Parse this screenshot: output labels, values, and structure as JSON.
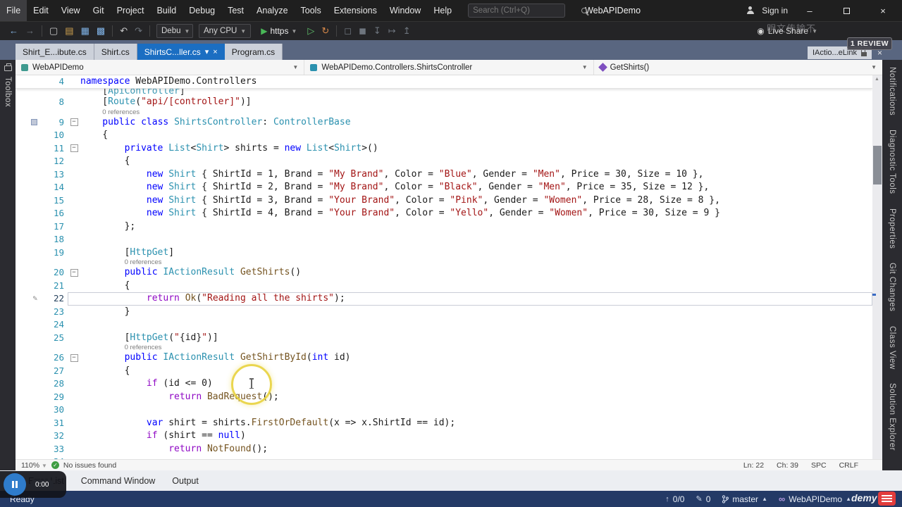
{
  "titlebar": {
    "menus": [
      "File",
      "Edit",
      "View",
      "Git",
      "Project",
      "Build",
      "Debug",
      "Test",
      "Analyze",
      "Tools",
      "Extensions",
      "Window",
      "Help"
    ],
    "search_placeholder": "Search (Ctrl+Q)",
    "app_title": "WebAPIDemo",
    "sign_in": "Sign in"
  },
  "toolbar": {
    "config_dropdown": "Debu",
    "platform_dropdown": "Any CPU",
    "run_label": "https",
    "live_share": "Live Share",
    "icons_left": [
      {
        "name": "nav-back-icon",
        "glyph": "←",
        "color": "#85b4e4"
      },
      {
        "name": "nav-forward-icon",
        "glyph": "→",
        "color": "#6e757e"
      },
      {
        "name": "sep"
      },
      {
        "name": "new-file-icon",
        "glyph": "▢",
        "color": "#c9c9c9"
      },
      {
        "name": "open-file-icon",
        "glyph": "▤",
        "color": "#cfa14f"
      },
      {
        "name": "save-icon",
        "glyph": "▦",
        "color": "#7fb2e6"
      },
      {
        "name": "save-all-icon",
        "glyph": "▩",
        "color": "#7fb2e6"
      },
      {
        "name": "sep"
      },
      {
        "name": "undo-icon",
        "glyph": "↶",
        "color": "#c9c9c9"
      },
      {
        "name": "redo-icon",
        "glyph": "↷",
        "color": "#6e757e"
      },
      {
        "name": "sep"
      }
    ],
    "icons_mid": [
      {
        "name": "run-without-debug-icon",
        "glyph": "▷",
        "color": "#5fbe6a"
      },
      {
        "name": "hot-reload-icon",
        "glyph": "↻",
        "color": "#d98a4a"
      },
      {
        "name": "sep"
      },
      {
        "name": "break-all-icon",
        "glyph": "◻",
        "color": "#6e757e"
      },
      {
        "name": "stop-icon",
        "glyph": "◼",
        "color": "#6e757e"
      },
      {
        "name": "step-into-icon",
        "glyph": "↧",
        "color": "#6e757e"
      },
      {
        "name": "step-over-icon",
        "glyph": "↦",
        "color": "#6e757e"
      },
      {
        "name": "step-out-icon",
        "glyph": "↥",
        "color": "#6e757e"
      }
    ]
  },
  "watermarks": {
    "top": "明文传输不",
    "review": "1 REVIEW",
    "bottom": "demy"
  },
  "tabs": {
    "items": [
      {
        "label": "Shirt_E...ibute.cs",
        "active": false
      },
      {
        "label": "Shirt.cs",
        "active": false
      },
      {
        "label": "ShirtsC...ller.cs",
        "active": true
      },
      {
        "label": "Program.cs",
        "active": false
      }
    ],
    "floating_tab": "IActio...eLink"
  },
  "breadcrumb": {
    "project": "WebAPIDemo",
    "type": "WebAPIDemo.Controllers.ShirtsController",
    "member": "GetShirts()"
  },
  "left_strip": {
    "label": "Toolbox"
  },
  "right_strip": {
    "labels": [
      "Notifications",
      "Diagnostic Tools",
      "Properties",
      "Git Changes",
      "Class View",
      "Solution Explorer"
    ]
  },
  "editor": {
    "sticky": {
      "n": "4",
      "ind": 0,
      "tokens": [
        [
          "k",
          "namespace"
        ],
        [
          "p",
          " WebAPIDemo.Controllers"
        ]
      ]
    },
    "lines": [
      {
        "n": "",
        "ind": 1,
        "partial": true,
        "tokens": [
          [
            "p",
            "["
          ],
          [
            "t",
            "ApiController"
          ],
          [
            "p",
            "]"
          ]
        ]
      },
      {
        "n": "8",
        "ind": 1,
        "tokens": [
          [
            "p",
            "["
          ],
          [
            "t",
            "Route"
          ],
          [
            "p",
            "("
          ],
          [
            "s",
            "\"api/[controller]\""
          ],
          [
            "p",
            ")]"
          ]
        ]
      },
      {
        "lens": "0 references",
        "ind": 1
      },
      {
        "n": "9",
        "ind": 1,
        "fold": true,
        "mark": true,
        "tokens": [
          [
            "k",
            "public"
          ],
          [
            "p",
            " "
          ],
          [
            "k",
            "class"
          ],
          [
            "p",
            " "
          ],
          [
            "t",
            "ShirtsController"
          ],
          [
            "p",
            ": "
          ],
          [
            "t",
            "ControllerBase"
          ]
        ]
      },
      {
        "n": "10",
        "ind": 1,
        "tokens": [
          [
            "p",
            "{"
          ]
        ]
      },
      {
        "n": "11",
        "ind": 2,
        "fold": true,
        "tokens": [
          [
            "k",
            "private"
          ],
          [
            "p",
            " "
          ],
          [
            "t",
            "List"
          ],
          [
            "p",
            "<"
          ],
          [
            "t",
            "Shirt"
          ],
          [
            "p",
            "> shirts = "
          ],
          [
            "k",
            "new"
          ],
          [
            "p",
            " "
          ],
          [
            "t",
            "List"
          ],
          [
            "p",
            "<"
          ],
          [
            "t",
            "Shirt"
          ],
          [
            "p",
            ">()"
          ]
        ]
      },
      {
        "n": "12",
        "ind": 2,
        "tokens": [
          [
            "p",
            "{"
          ]
        ]
      },
      {
        "n": "13",
        "ind": 3,
        "tokens": [
          [
            "k",
            "new"
          ],
          [
            "p",
            " "
          ],
          [
            "t",
            "Shirt"
          ],
          [
            "p",
            " { ShirtId = 1, Brand = "
          ],
          [
            "s",
            "\"My Brand\""
          ],
          [
            "p",
            ", Color = "
          ],
          [
            "s",
            "\"Blue\""
          ],
          [
            "p",
            ", Gender = "
          ],
          [
            "s",
            "\"Men\""
          ],
          [
            "p",
            ", Price = 30, Size = 10 },"
          ]
        ]
      },
      {
        "n": "14",
        "ind": 3,
        "tokens": [
          [
            "k",
            "new"
          ],
          [
            "p",
            " "
          ],
          [
            "t",
            "Shirt"
          ],
          [
            "p",
            " { ShirtId = 2, Brand = "
          ],
          [
            "s",
            "\"My Brand\""
          ],
          [
            "p",
            ", Color = "
          ],
          [
            "s",
            "\"Black\""
          ],
          [
            "p",
            ", Gender = "
          ],
          [
            "s",
            "\"Men\""
          ],
          [
            "p",
            ", Price = 35, Size = 12 },"
          ]
        ]
      },
      {
        "n": "15",
        "ind": 3,
        "tokens": [
          [
            "k",
            "new"
          ],
          [
            "p",
            " "
          ],
          [
            "t",
            "Shirt"
          ],
          [
            "p",
            " { ShirtId = 3, Brand = "
          ],
          [
            "s",
            "\"Your Brand\""
          ],
          [
            "p",
            ", Color = "
          ],
          [
            "s",
            "\"Pink\""
          ],
          [
            "p",
            ", Gender = "
          ],
          [
            "s",
            "\"Women\""
          ],
          [
            "p",
            ", Price = 28, Size = 8 },"
          ]
        ]
      },
      {
        "n": "16",
        "ind": 3,
        "tokens": [
          [
            "k",
            "new"
          ],
          [
            "p",
            " "
          ],
          [
            "t",
            "Shirt"
          ],
          [
            "p",
            " { ShirtId = 4, Brand = "
          ],
          [
            "s",
            "\"Your Brand\""
          ],
          [
            "p",
            ", Color = "
          ],
          [
            "s",
            "\"Yello\""
          ],
          [
            "p",
            ", Gender = "
          ],
          [
            "s",
            "\"Women\""
          ],
          [
            "p",
            ", Price = 30, Size = 9 }"
          ]
        ]
      },
      {
        "n": "17",
        "ind": 2,
        "tokens": [
          [
            "p",
            "};"
          ]
        ]
      },
      {
        "n": "18",
        "ind": 0,
        "tokens": []
      },
      {
        "n": "19",
        "ind": 2,
        "tokens": [
          [
            "p",
            "["
          ],
          [
            "t",
            "HttpGet"
          ],
          [
            "p",
            "]"
          ]
        ]
      },
      {
        "lens": "0 references",
        "ind": 2
      },
      {
        "n": "20",
        "ind": 2,
        "fold": true,
        "tokens": [
          [
            "k",
            "public"
          ],
          [
            "p",
            " "
          ],
          [
            "t",
            "IActionResult"
          ],
          [
            "p",
            " "
          ],
          [
            "m",
            "GetShirts"
          ],
          [
            "p",
            "()"
          ]
        ]
      },
      {
        "n": "21",
        "ind": 2,
        "tokens": [
          [
            "p",
            "{"
          ]
        ]
      },
      {
        "n": "22",
        "ind": 3,
        "cur": true,
        "pencil": true,
        "tokens": [
          [
            "c",
            "return"
          ],
          [
            "p",
            " "
          ],
          [
            "m",
            "Ok"
          ],
          [
            "p",
            "("
          ],
          [
            "s",
            "\"Reading all the shirts\""
          ],
          [
            "p",
            ");"
          ]
        ]
      },
      {
        "n": "23",
        "ind": 2,
        "tokens": [
          [
            "p",
            "}"
          ]
        ]
      },
      {
        "n": "24",
        "ind": 0,
        "tokens": []
      },
      {
        "n": "25",
        "ind": 2,
        "tokens": [
          [
            "p",
            "["
          ],
          [
            "t",
            "HttpGet"
          ],
          [
            "p",
            "("
          ],
          [
            "s",
            "\""
          ],
          [
            "p",
            "{id}"
          ],
          [
            "s",
            "\""
          ],
          [
            "p",
            ")]"
          ]
        ]
      },
      {
        "lens": "0 references",
        "ind": 2
      },
      {
        "n": "26",
        "ind": 2,
        "fold": true,
        "tokens": [
          [
            "k",
            "public"
          ],
          [
            "p",
            " "
          ],
          [
            "t",
            "IActionResult"
          ],
          [
            "p",
            " "
          ],
          [
            "m",
            "GetShirtById"
          ],
          [
            "p",
            "("
          ],
          [
            "k",
            "int"
          ],
          [
            "p",
            " id)"
          ]
        ]
      },
      {
        "n": "27",
        "ind": 2,
        "tokens": [
          [
            "p",
            "{"
          ]
        ]
      },
      {
        "n": "28",
        "ind": 3,
        "tokens": [
          [
            "c",
            "if"
          ],
          [
            "p",
            " (id <= 0)"
          ]
        ]
      },
      {
        "n": "29",
        "ind": 4,
        "tokens": [
          [
            "c",
            "return"
          ],
          [
            "p",
            " "
          ],
          [
            "m",
            "BadRequest"
          ],
          [
            "p",
            "();"
          ]
        ]
      },
      {
        "n": "30",
        "ind": 0,
        "tokens": []
      },
      {
        "n": "31",
        "ind": 3,
        "tokens": [
          [
            "k",
            "var"
          ],
          [
            "p",
            " shirt = shirts."
          ],
          [
            "m",
            "FirstOrDefault"
          ],
          [
            "p",
            "(x => x.ShirtId == id);"
          ]
        ]
      },
      {
        "n": "32",
        "ind": 3,
        "tokens": [
          [
            "c",
            "if"
          ],
          [
            "p",
            " (shirt == "
          ],
          [
            "k",
            "null"
          ],
          [
            "p",
            ")"
          ]
        ]
      },
      {
        "n": "33",
        "ind": 4,
        "tokens": [
          [
            "c",
            "return"
          ],
          [
            "p",
            " "
          ],
          [
            "m",
            "NotFound"
          ],
          [
            "p",
            "();"
          ]
        ]
      },
      {
        "n": "34",
        "ind": 2,
        "tokens": []
      }
    ]
  },
  "editor_status": {
    "zoom": "110%",
    "issues": "No issues found",
    "ln": "Ln: 22",
    "ch": "Ch: 39",
    "spc": "SPC",
    "eol": "CRLF"
  },
  "panel_tabs": [
    "Error List",
    "Command Window",
    "Output"
  ],
  "video_overlay": {
    "time": "0:00"
  },
  "statusbar": {
    "ready": "Ready",
    "sync": "0/0",
    "pending": "0",
    "branch": "master",
    "repo": "WebAPIDemo"
  }
}
